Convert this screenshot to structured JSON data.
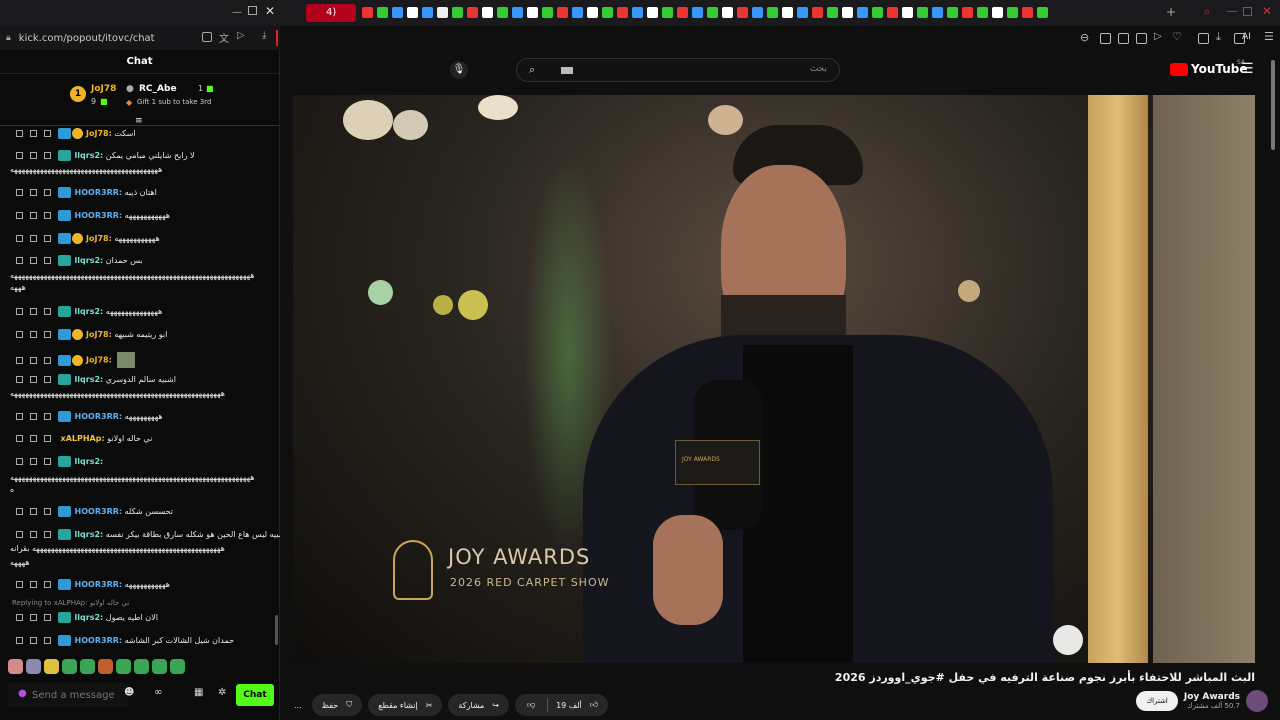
{
  "browser": {
    "tab_label": "4)",
    "url": "kick.com/popout/itovc/chat",
    "ai_label": "AI"
  },
  "chat": {
    "title": "Chat",
    "leaderboard": [
      {
        "rank": "1",
        "name": "JoJ78",
        "count": "9"
      },
      {
        "rank": "",
        "name": "RC_Abe",
        "count": "1"
      }
    ],
    "gift_text": "Gift 1 sub to take 3rd",
    "messages": [
      {
        "user": "JoJ78:",
        "text": "اسكت",
        "badge": "gold"
      },
      {
        "user": "llqrs2:",
        "text": "لا رايح شايلني مبامي يمكن",
        "badge": "g"
      },
      {
        "user": "HOOR3RR:",
        "text": "اهتان ذيبه",
        "badge": "b"
      },
      {
        "user": "HOOR3RR:",
        "text": "هههههههههههه",
        "badge": "b"
      },
      {
        "user": "JoJ78:",
        "text": "هههههههههههه",
        "badge": "gold"
      },
      {
        "user": "llqrs2:",
        "text": "بس حمدان",
        "badge": "g"
      },
      {
        "user": "llqrs2:",
        "text": "ههههههههههههههه",
        "badge": "g"
      },
      {
        "user": "JoJ78:",
        "text": "ابو ريتيمه شبيهه",
        "badge": "gold"
      },
      {
        "user": "JoJ78:",
        "text": "",
        "badge": "gold"
      },
      {
        "user": "llqrs2:",
        "text": "اشبيه سالم الدوسري",
        "badge": "g"
      },
      {
        "user": "HOOR3RR:",
        "text": "هههههههههه",
        "badge": "b"
      },
      {
        "user": "xALPHAp:",
        "text": "ني حاله اولانو",
        "badge": "none"
      },
      {
        "user": "llqrs2:",
        "text": "",
        "badge": "g"
      },
      {
        "user": "HOOR3RR:",
        "text": "تحسسن شكله",
        "badge": "b"
      },
      {
        "user": "llqrs2:",
        "text": "اشبيه ليس هاع الحين هو شكله سارق بطاقة بيكر نفسه",
        "badge": "g"
      },
      {
        "user": "HOOR3RR:",
        "text": "هههههههههههه",
        "badge": "b"
      },
      {
        "user": "llqrs2:",
        "text": "الان اطيه يصول",
        "badge": "g"
      },
      {
        "user": "HOOR3RR:",
        "text": "حمدان شيل الشالات كبر الشاشه",
        "badge": "b"
      }
    ],
    "continuations": [
      "ههههههههههههههههههههههههههههههههههههههههه",
      "هههههههههههههههههههههههههههههههههههههههههههههههههههههههههههههههههه",
      "هههه",
      "هههههههههههههههههههههههههههههههههههههههههههههههههههههههههه",
      "هههههههههههههههههههههههههههههههههههههههههههههههههههههههههههههههههه",
      "ه",
      "هههههههههههههههههههههههههههههههههههههههههههههههههههه بقرانه",
      "ههههه"
    ],
    "reply_text": "Replying to xALPHAp: ني حاله اولانو",
    "input_placeholder": "Send a message",
    "chat_button": "Chat"
  },
  "youtube": {
    "logo": "YouTube",
    "region": "SA",
    "search_placeholder": "بحث",
    "video_title": "البث المباشر للاحتفاء بأبرز نجوم صناعة الترفيه في حفل #جوي_اووردز 2026",
    "overlay_brand": "JOY AWARDS",
    "overlay_sub": "2026 RED CARPET SHOW",
    "mic_text": "JOY AWARDS",
    "channel_name": "Joy Awards",
    "subscribers": "50.7 ألف مشترك",
    "subscribe_label": "اشتراك",
    "likes": "19 ألف",
    "share_label": "مشاركة",
    "clip_label": "إنشاء مقطع",
    "save_label": "حفظ",
    "more_label": "..."
  }
}
